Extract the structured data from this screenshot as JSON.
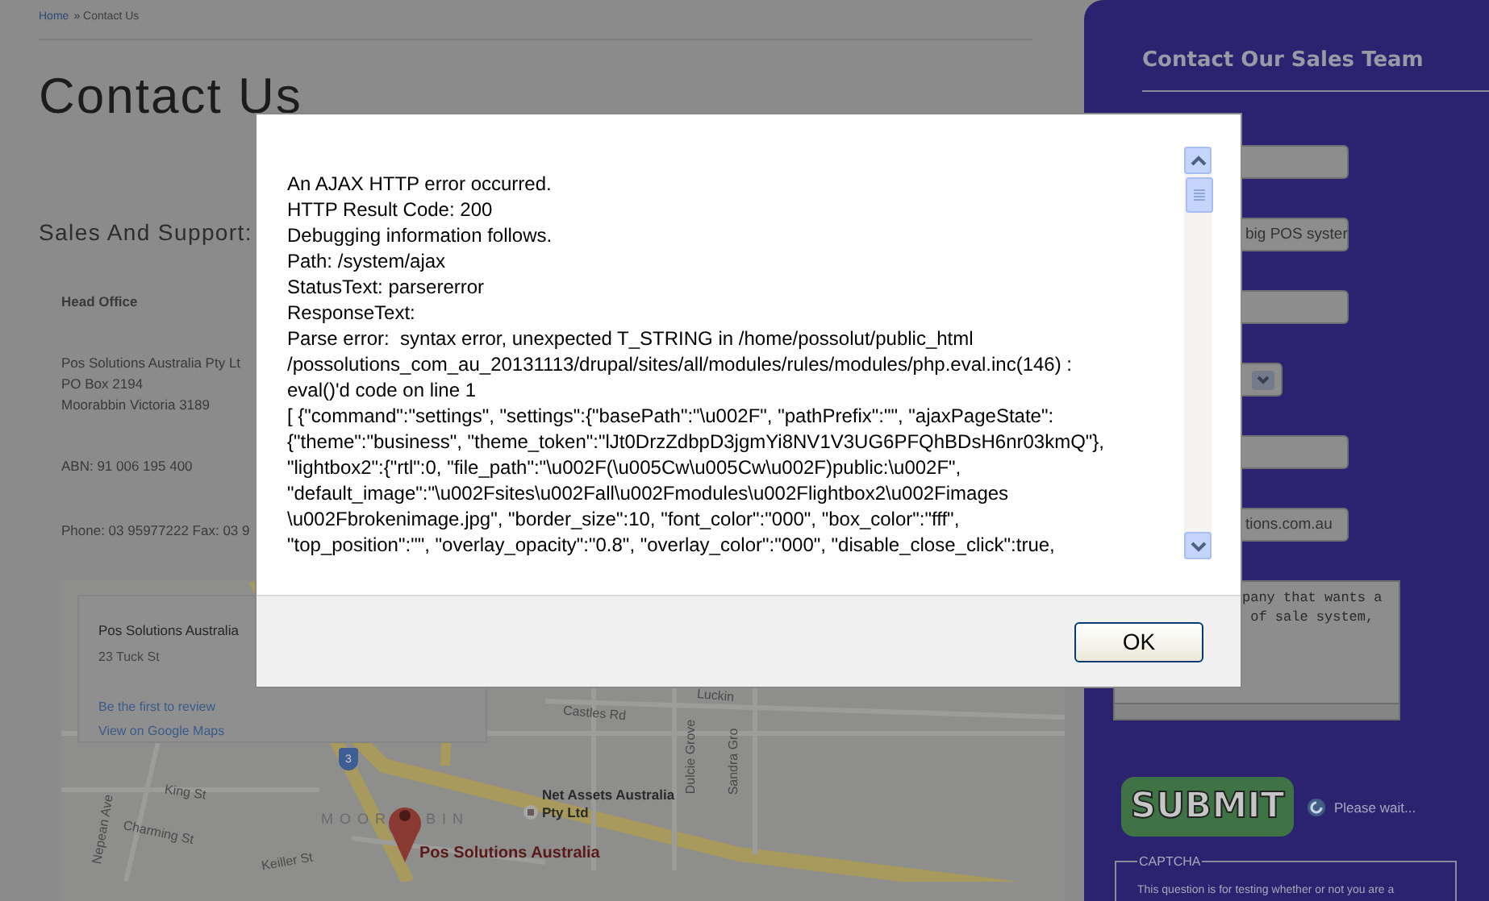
{
  "breadcrumb": {
    "link": "Home",
    "rest": "» Contact Us"
  },
  "page_title": "Contact Us",
  "section_title": "Sales And Support:",
  "office": {
    "heading": "Head Office",
    "address_lines": [
      "Pos Solutions Australia Pty Lt",
      "PO Box 2194",
      "Moorabbin Victoria 3189"
    ],
    "abn": "ABN: 91 006 195 400",
    "phone": "Phone: 03 95977222 Fax: 03 9"
  },
  "map": {
    "info_card": {
      "name": "Pos Solutions Australia",
      "address": "23 Tuck St",
      "links": [
        "Be the first to review",
        "View on Google Maps"
      ]
    },
    "route_badge": "3",
    "labels": [
      {
        "text": "King St",
        "kind": "street"
      },
      {
        "text": "Charming St",
        "kind": "street"
      },
      {
        "text": "Keiller St",
        "kind": "street"
      },
      {
        "text": "Nepean Ave",
        "kind": "street"
      },
      {
        "text": "Castles Rd",
        "kind": "street"
      },
      {
        "text": "Dulcie Grove",
        "kind": "street"
      },
      {
        "text": "Sandra Gro",
        "kind": "street"
      },
      {
        "text": "Luckin",
        "kind": "street"
      },
      {
        "text": "MOOR",
        "kind": "area"
      },
      {
        "text": "BIN",
        "kind": "area"
      },
      {
        "text": "Net Assets Australia Pty Ltd",
        "kind": "business"
      },
      {
        "text": "Pos Solutions Australia",
        "kind": "place"
      }
    ]
  },
  "sidebar": {
    "title": "Contact Our Sales Team",
    "fields": [
      {
        "kind": "input"
      },
      {
        "kind": "input",
        "value": "big POS syster"
      },
      {
        "kind": "input"
      },
      {
        "kind": "select"
      },
      {
        "kind": "input"
      },
      {
        "kind": "input",
        "value": "tions.com.au"
      },
      {
        "kind": "textarea",
        "value_lines": [
          "pany that wants a",
          " of sale system,"
        ]
      }
    ],
    "submit": "SUBMIT",
    "wait_text": "Please wait...",
    "captcha": {
      "legend": "CAPTCHA",
      "text": "This question is for testing whether or not you are a"
    }
  },
  "dialog": {
    "message_lines": [
      "An AJAX HTTP error occurred.",
      "HTTP Result Code: 200",
      "Debugging information follows.",
      "Path: /system/ajax",
      "StatusText: parsererror",
      "ResponseText:",
      "Parse error:  syntax error, unexpected T_STRING in /home/possolut/public_html",
      "/possolutions_com_au_20131113/drupal/sites/all/modules/rules/modules/php.eval.inc(146) :",
      "eval()'d code on line 1",
      "[ {\"command\":\"settings\", \"settings\":{\"basePath\":\"\\u002F\", \"pathPrefix\":\"\", \"ajaxPageState\":",
      "{\"theme\":\"business\", \"theme_token\":\"lJt0DrzZdbpD3jgmYi8NV1V3UG6PFQhBDsH6nr03kmQ\"},",
      "\"lightbox2\":{\"rtl\":0, \"file_path\":\"\\u002F(\\u005Cw\\u005Cw\\u002F)public:\\u002F\",",
      "\"default_image\":\"\\u002Fsites\\u002Fall\\u002Fmodules\\u002Flightbox2\\u002Fimages",
      "\\u002Fbrokenimage.jpg\", \"border_size\":10, \"font_color\":\"000\", \"box_color\":\"fff\",",
      "\"top_position\":\"\", \"overlay_opacity\":\"0.8\", \"overlay_color\":\"000\", \"disable_close_click\":true,"
    ],
    "ok": "OK"
  }
}
